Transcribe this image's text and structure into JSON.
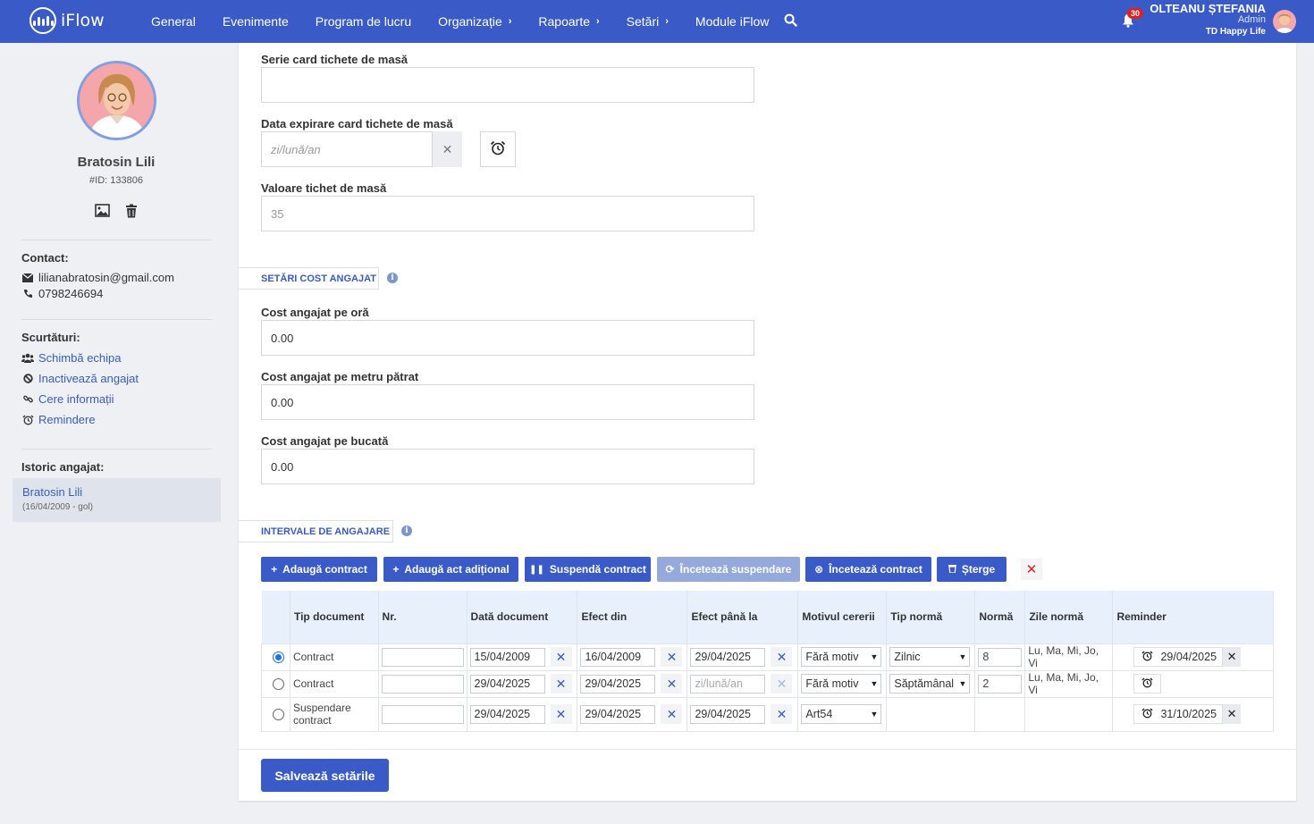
{
  "app": {
    "name": "iFlow"
  },
  "nav": {
    "items": [
      {
        "label": "General",
        "chevron": false
      },
      {
        "label": "Evenimente",
        "chevron": false
      },
      {
        "label": "Program de lucru",
        "chevron": false
      },
      {
        "label": "Organizație",
        "chevron": true
      },
      {
        "label": "Rapoarte",
        "chevron": true
      },
      {
        "label": "Setări",
        "chevron": true
      },
      {
        "label": "Module iFlow",
        "chevron": false
      }
    ],
    "notifications_count": "30"
  },
  "user": {
    "name": "OLTEANU ȘTEFANIA",
    "role": "Admin",
    "company": "TD Happy Life"
  },
  "employee": {
    "name": "Bratosin Lili",
    "id": "#ID: 133806",
    "contact_label": "Contact:",
    "email": "lilianabratosin@gmail.com",
    "phone": "0798246694",
    "shortcuts_label": "Scurtături:",
    "shortcuts": [
      {
        "label": "Schimbă echipa",
        "icon": "users-icon"
      },
      {
        "label": "Inactivează angajat",
        "icon": "ban-icon"
      },
      {
        "label": "Cere informații",
        "icon": "link-icon"
      },
      {
        "label": "Remindere",
        "icon": "alarm-icon"
      }
    ],
    "history_label": "Istoric angajat:",
    "history_item": {
      "name": "Bratosin Lili",
      "period": "(16/04/2009 - gol)"
    }
  },
  "form": {
    "meal_card_series": {
      "label": "Serie card tichete de masă",
      "value": ""
    },
    "meal_card_expiry": {
      "label": "Data expirare card tichete de masă",
      "placeholder": "zi/lună/an"
    },
    "meal_ticket_value": {
      "label": "Valoare tichet de masă",
      "value": "35"
    },
    "cost_section_title": "SETĂRI COST ANGAJAT",
    "cost_per_hour": {
      "label": "Cost angajat pe oră",
      "value": "0.00"
    },
    "cost_per_sqm": {
      "label": "Cost angajat pe metru pătrat",
      "value": "0.00"
    },
    "cost_per_piece": {
      "label": "Cost angajat pe bucată",
      "value": "0.00"
    },
    "intervals_section_title": "INTERVALE DE ANGAJARE"
  },
  "actions": {
    "add_contract": "Adaugă contract",
    "add_addendum": "Adaugă act adițional",
    "suspend_contract": "Suspendă contract",
    "end_suspension": "Încetează suspendare",
    "end_contract": "Încetează contract",
    "delete": "Șterge"
  },
  "table": {
    "headers": [
      "Tip document",
      "Nr.",
      "Dată document",
      "Efect din",
      "Efect până la",
      "Motivul cererii",
      "Tip normă",
      "Normă",
      "Zile normă",
      "Reminder"
    ],
    "rows": [
      {
        "selected": true,
        "type": "Contract",
        "nr": "",
        "doc_date": "15/04/2009",
        "from": "16/04/2009",
        "to": "29/04/2025",
        "reason": "Fără motiv",
        "norm_type": "Zilnic",
        "norm": "8",
        "days": "Lu, Ma, Mi, Jo, Vi",
        "reminder": "29/04/2025"
      },
      {
        "selected": false,
        "type": "Contract",
        "nr": "",
        "doc_date": "29/04/2025",
        "from": "29/04/2025",
        "to": "zi/lună/an",
        "reason": "Fără motiv",
        "norm_type": "Săptămânal",
        "norm": "2",
        "days": "Lu, Ma, Mi, Jo, Vi",
        "reminder": ""
      },
      {
        "selected": false,
        "type": "Suspendare contract",
        "nr": "",
        "doc_date": "29/04/2025",
        "from": "29/04/2025",
        "to": "29/04/2025",
        "reason": "Art54",
        "norm_type": "",
        "norm": "",
        "days": "",
        "reminder": "31/10/2025"
      }
    ]
  },
  "save_label": "Salvează setările"
}
